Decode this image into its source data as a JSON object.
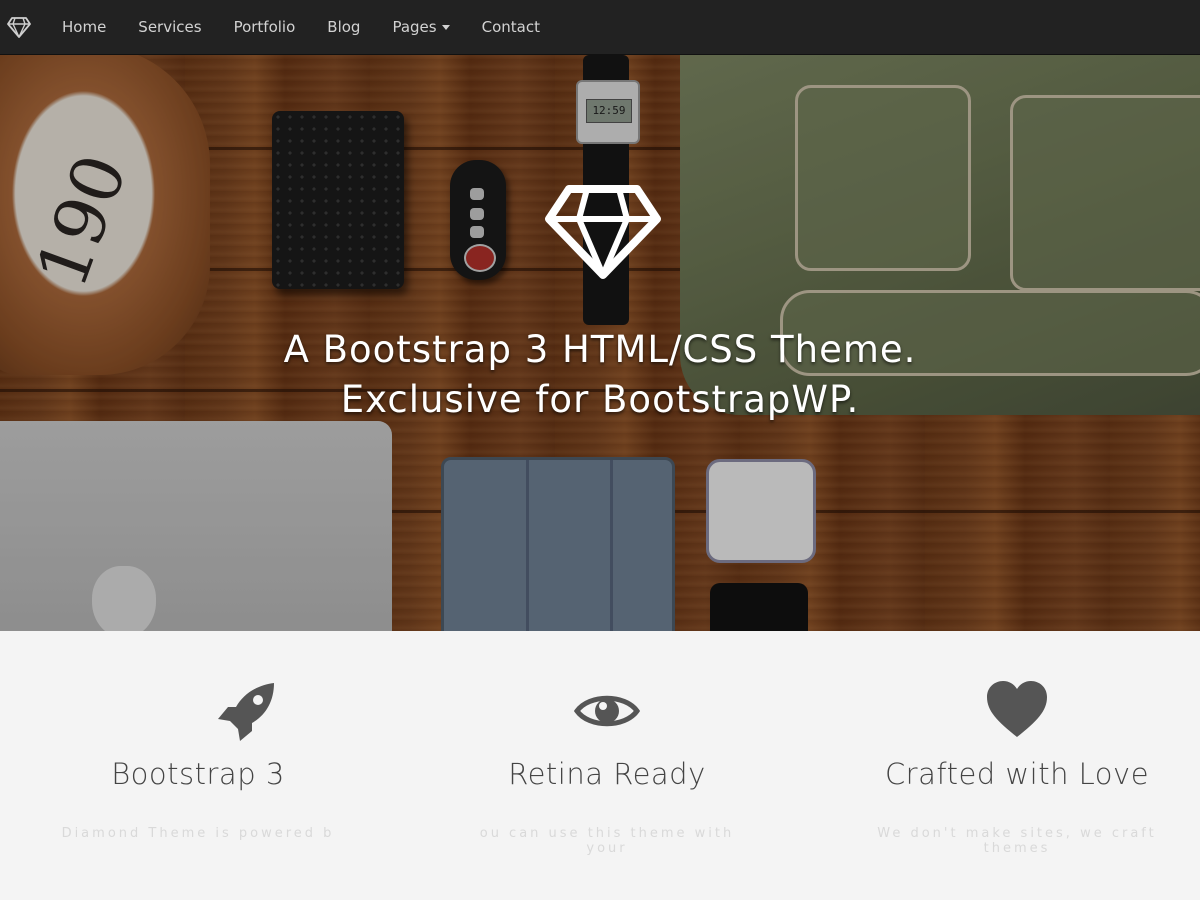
{
  "navbar": {
    "brand_icon": "diamond-icon",
    "items": [
      {
        "label": "Home"
      },
      {
        "label": "Services"
      },
      {
        "label": "Portfolio"
      },
      {
        "label": "Blog"
      },
      {
        "label": "Pages",
        "dropdown": true
      },
      {
        "label": "Contact"
      }
    ]
  },
  "hero": {
    "icon": "diamond-icon",
    "title_line1": "A Bootstrap 3 HTML/CSS Theme.",
    "title_line2": "Exclusive for BootstrapWP.",
    "watch_display": "12:59",
    "shoe_text": "190"
  },
  "features": [
    {
      "icon": "rocket-icon",
      "title": "Bootstrap 3",
      "desc": "Diamond Theme is powered b"
    },
    {
      "icon": "eye-icon",
      "title": "Retina Ready",
      "desc": "ou can use this theme with your"
    },
    {
      "icon": "heart-icon",
      "title": "Crafted with Love",
      "desc": "We don't make sites, we craft themes"
    }
  ],
  "colors": {
    "navbar_bg": "#222222",
    "nav_text": "#d2d2d2",
    "features_bg": "#f4f4f4",
    "feature_title": "#444444",
    "icon_color": "#555555"
  }
}
